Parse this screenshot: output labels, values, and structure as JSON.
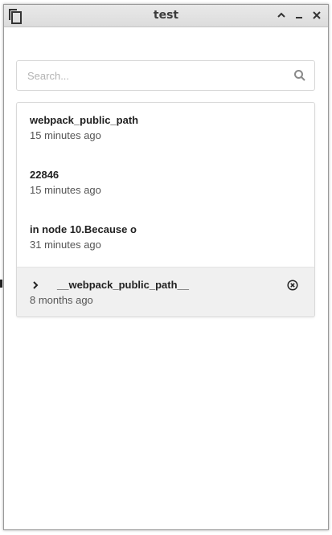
{
  "window": {
    "title": "test"
  },
  "search": {
    "placeholder": "Search..."
  },
  "items": [
    {
      "title": "webpack_public_path",
      "time": "15 minutes ago"
    },
    {
      "title": "22846",
      "time": "15 minutes ago"
    },
    {
      "title": "in node 10.Because o",
      "time": "31 minutes ago"
    },
    {
      "title": "__webpack_public_path__",
      "time": "8 months ago",
      "selected": true
    }
  ],
  "colors": {
    "titlebar": "#dcdcdc",
    "selected_row": "#f0f0f0",
    "border": "#d9d9d9",
    "text": "#222222"
  },
  "icons": {
    "app": "copy-icon",
    "collapse": "chevron-up-icon",
    "minimize": "minimize-icon",
    "close": "close-icon",
    "search": "search-icon",
    "expand": "chevron-right-icon",
    "remove": "circle-x-icon"
  }
}
